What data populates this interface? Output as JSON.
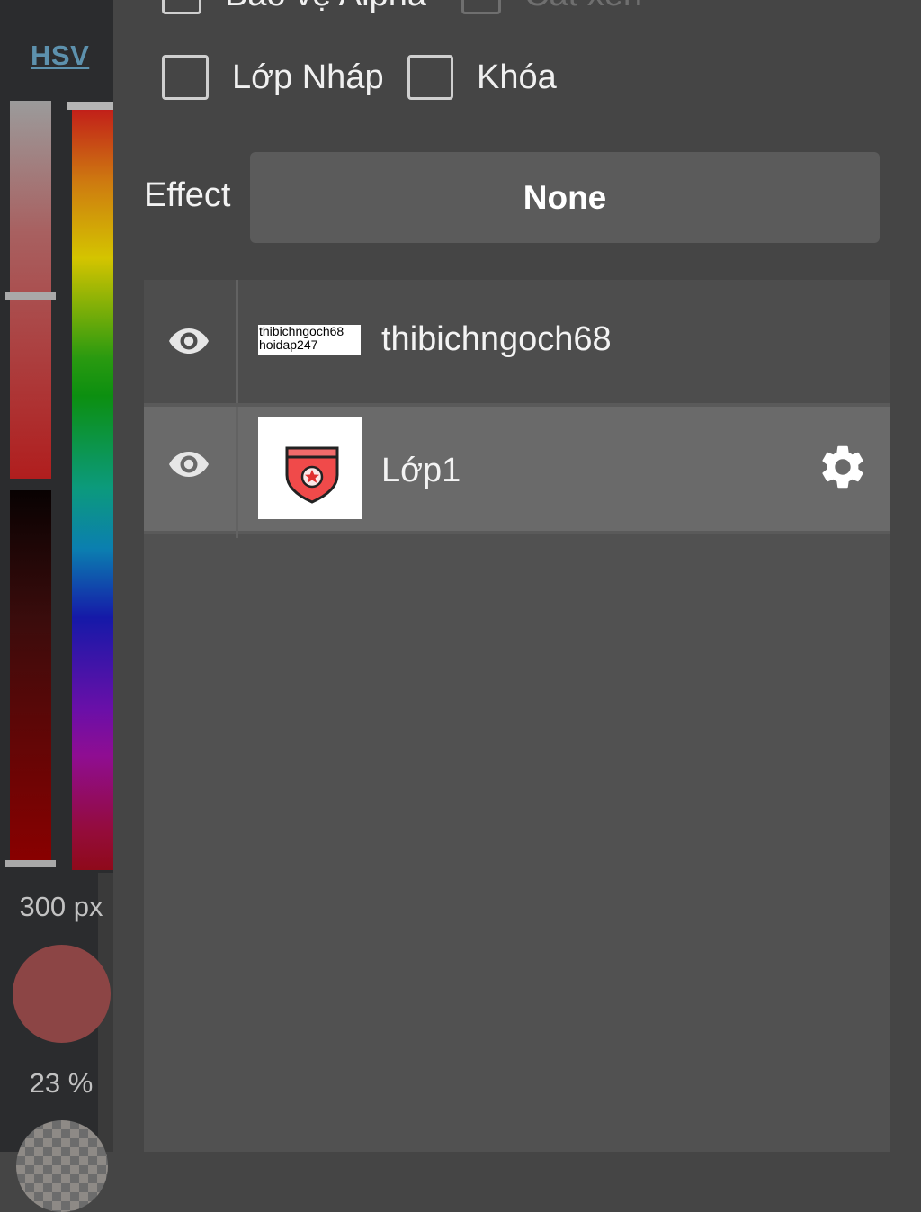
{
  "color_panel": {
    "mode_label": "HSV",
    "brush_size": "300 px",
    "opacity": "23 %",
    "current_color": "#8c4545"
  },
  "layer_options": {
    "checkboxes": [
      {
        "label": "Bảo vệ Alpha",
        "checked": false,
        "enabled": true
      },
      {
        "label": "Cắt xén",
        "checked": false,
        "enabled": false
      },
      {
        "label": "Lớp Nháp",
        "checked": false,
        "enabled": true
      },
      {
        "label": "Khóa",
        "checked": false,
        "enabled": true
      }
    ]
  },
  "effect": {
    "label": "Effect",
    "value": "None"
  },
  "layers": [
    {
      "name": "thibichngoch68",
      "visible": true,
      "selected": false,
      "thumbnail_text": [
        "thibichngoch68",
        "hoidap247"
      ],
      "eye_icon": "eye-icon"
    },
    {
      "name": "Lớp1",
      "visible": true,
      "selected": true,
      "thumbnail_icon": "red-pocket-badge",
      "eye_icon": "eye-icon",
      "settings_icon": "gear-icon"
    }
  ]
}
